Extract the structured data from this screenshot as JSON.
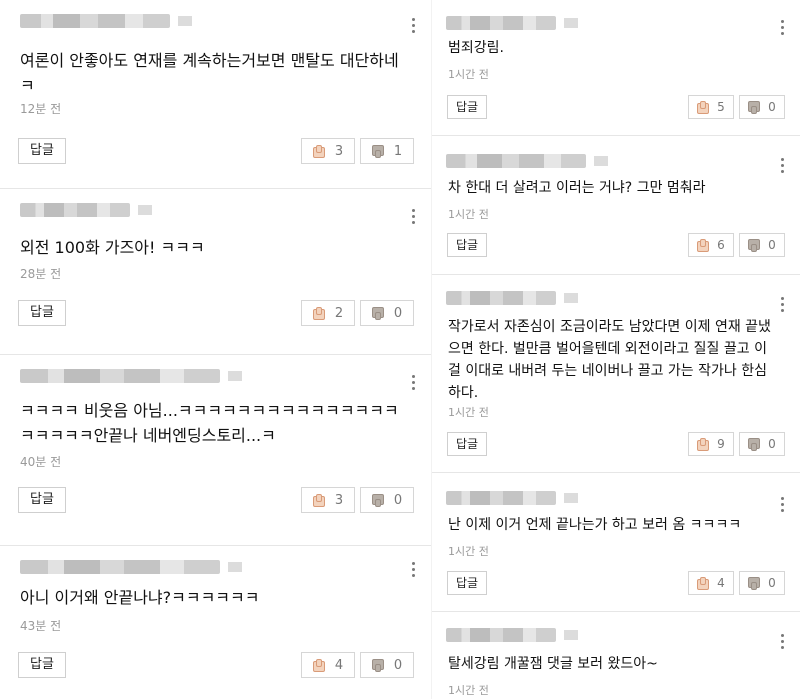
{
  "reply_label": "답글",
  "left": [
    {
      "text": "여론이 안좋아도 연재를 계속하는거보면 맨탈도 대단하네 ㅋ",
      "time": "12분 전",
      "likes": "3",
      "dislikes": "1"
    },
    {
      "text": "외전 100화 가즈아! ㅋㅋㅋ",
      "time": "28분 전",
      "likes": "2",
      "dislikes": "0"
    },
    {
      "text": "ㅋㅋㅋㅋ 비웃음 아님...ㅋㅋㅋㅋㅋㅋㅋㅋㅋㅋㅋㅋㅋㅋㅋㅋㅋㅋㅋㅋ안끝나 네버엔딩스토리...ㅋ",
      "time": "40분 전",
      "likes": "3",
      "dislikes": "0"
    },
    {
      "text": "아니 이거왜 안끝나냐?ㅋㅋㅋㅋㅋㅋ",
      "time": "43분 전",
      "likes": "4",
      "dislikes": "0"
    }
  ],
  "right": [
    {
      "text": "범죄강림.",
      "time": "1시간 전",
      "likes": "5",
      "dislikes": "0"
    },
    {
      "text": "차 한대 더 살려고 이러는 거냐? 그만 멈춰라",
      "time": "1시간 전",
      "likes": "6",
      "dislikes": "0"
    },
    {
      "text": "작가로서 자존심이 조금이라도 남았다면 이제 연재 끝냈으면 한다. 벌만큼 벌어을텐데 외전이라고 질질 끌고 이걸 이대로 내버려 두는 네이버나 끌고 가는 작가나 한심하다.",
      "time": "1시간 전",
      "likes": "9",
      "dislikes": "0"
    },
    {
      "text": "난 이제 이거 언제 끝나는가 하고 보러 옴 ㅋㅋㅋㅋ",
      "time": "1시간 전",
      "likes": "4",
      "dislikes": "0"
    },
    {
      "text": "탈세강림 개꿀잼 댓글 보러 왔드아~",
      "time": "1시간 전",
      "likes": "",
      "dislikes": ""
    }
  ]
}
